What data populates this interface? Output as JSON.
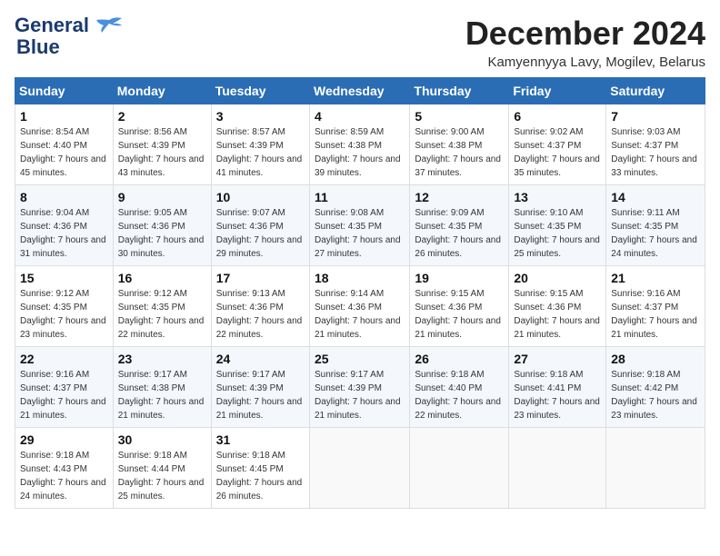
{
  "header": {
    "logo": {
      "line1": "General",
      "line2": "Blue"
    },
    "month": "December 2024",
    "location": "Kamyennyya Lavy, Mogilev, Belarus"
  },
  "weekdays": [
    "Sunday",
    "Monday",
    "Tuesday",
    "Wednesday",
    "Thursday",
    "Friday",
    "Saturday"
  ],
  "weeks": [
    [
      {
        "day": "1",
        "sunrise": "8:54 AM",
        "sunset": "4:40 PM",
        "daylight": "7 hours and 45 minutes."
      },
      {
        "day": "2",
        "sunrise": "8:56 AM",
        "sunset": "4:39 PM",
        "daylight": "7 hours and 43 minutes."
      },
      {
        "day": "3",
        "sunrise": "8:57 AM",
        "sunset": "4:39 PM",
        "daylight": "7 hours and 41 minutes."
      },
      {
        "day": "4",
        "sunrise": "8:59 AM",
        "sunset": "4:38 PM",
        "daylight": "7 hours and 39 minutes."
      },
      {
        "day": "5",
        "sunrise": "9:00 AM",
        "sunset": "4:38 PM",
        "daylight": "7 hours and 37 minutes."
      },
      {
        "day": "6",
        "sunrise": "9:02 AM",
        "sunset": "4:37 PM",
        "daylight": "7 hours and 35 minutes."
      },
      {
        "day": "7",
        "sunrise": "9:03 AM",
        "sunset": "4:37 PM",
        "daylight": "7 hours and 33 minutes."
      }
    ],
    [
      {
        "day": "8",
        "sunrise": "9:04 AM",
        "sunset": "4:36 PM",
        "daylight": "7 hours and 31 minutes."
      },
      {
        "day": "9",
        "sunrise": "9:05 AM",
        "sunset": "4:36 PM",
        "daylight": "7 hours and 30 minutes."
      },
      {
        "day": "10",
        "sunrise": "9:07 AM",
        "sunset": "4:36 PM",
        "daylight": "7 hours and 29 minutes."
      },
      {
        "day": "11",
        "sunrise": "9:08 AM",
        "sunset": "4:35 PM",
        "daylight": "7 hours and 27 minutes."
      },
      {
        "day": "12",
        "sunrise": "9:09 AM",
        "sunset": "4:35 PM",
        "daylight": "7 hours and 26 minutes."
      },
      {
        "day": "13",
        "sunrise": "9:10 AM",
        "sunset": "4:35 PM",
        "daylight": "7 hours and 25 minutes."
      },
      {
        "day": "14",
        "sunrise": "9:11 AM",
        "sunset": "4:35 PM",
        "daylight": "7 hours and 24 minutes."
      }
    ],
    [
      {
        "day": "15",
        "sunrise": "9:12 AM",
        "sunset": "4:35 PM",
        "daylight": "7 hours and 23 minutes."
      },
      {
        "day": "16",
        "sunrise": "9:12 AM",
        "sunset": "4:35 PM",
        "daylight": "7 hours and 22 minutes."
      },
      {
        "day": "17",
        "sunrise": "9:13 AM",
        "sunset": "4:36 PM",
        "daylight": "7 hours and 22 minutes."
      },
      {
        "day": "18",
        "sunrise": "9:14 AM",
        "sunset": "4:36 PM",
        "daylight": "7 hours and 21 minutes."
      },
      {
        "day": "19",
        "sunrise": "9:15 AM",
        "sunset": "4:36 PM",
        "daylight": "7 hours and 21 minutes."
      },
      {
        "day": "20",
        "sunrise": "9:15 AM",
        "sunset": "4:36 PM",
        "daylight": "7 hours and 21 minutes."
      },
      {
        "day": "21",
        "sunrise": "9:16 AM",
        "sunset": "4:37 PM",
        "daylight": "7 hours and 21 minutes."
      }
    ],
    [
      {
        "day": "22",
        "sunrise": "9:16 AM",
        "sunset": "4:37 PM",
        "daylight": "7 hours and 21 minutes."
      },
      {
        "day": "23",
        "sunrise": "9:17 AM",
        "sunset": "4:38 PM",
        "daylight": "7 hours and 21 minutes."
      },
      {
        "day": "24",
        "sunrise": "9:17 AM",
        "sunset": "4:39 PM",
        "daylight": "7 hours and 21 minutes."
      },
      {
        "day": "25",
        "sunrise": "9:17 AM",
        "sunset": "4:39 PM",
        "daylight": "7 hours and 21 minutes."
      },
      {
        "day": "26",
        "sunrise": "9:18 AM",
        "sunset": "4:40 PM",
        "daylight": "7 hours and 22 minutes."
      },
      {
        "day": "27",
        "sunrise": "9:18 AM",
        "sunset": "4:41 PM",
        "daylight": "7 hours and 23 minutes."
      },
      {
        "day": "28",
        "sunrise": "9:18 AM",
        "sunset": "4:42 PM",
        "daylight": "7 hours and 23 minutes."
      }
    ],
    [
      {
        "day": "29",
        "sunrise": "9:18 AM",
        "sunset": "4:43 PM",
        "daylight": "7 hours and 24 minutes."
      },
      {
        "day": "30",
        "sunrise": "9:18 AM",
        "sunset": "4:44 PM",
        "daylight": "7 hours and 25 minutes."
      },
      {
        "day": "31",
        "sunrise": "9:18 AM",
        "sunset": "4:45 PM",
        "daylight": "7 hours and 26 minutes."
      },
      null,
      null,
      null,
      null
    ]
  ]
}
